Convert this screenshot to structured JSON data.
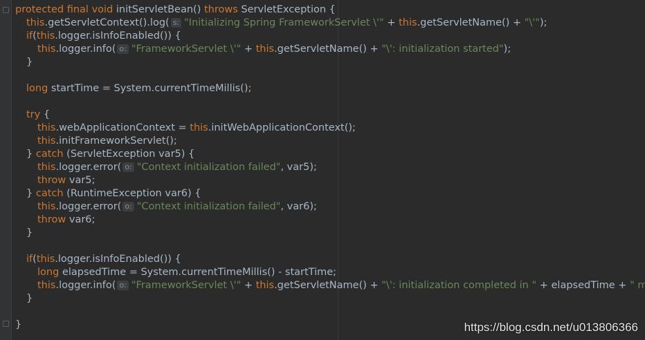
{
  "editor": {
    "watermark": "https://blog.csdn.net/u013806366",
    "tokens": {
      "protected": "protected",
      "final": "final",
      "void": "void",
      "throws": "throws",
      "this": "this",
      "if": "if",
      "long": "long",
      "try": "try",
      "catch": "catch",
      "throw": "throw"
    },
    "code": {
      "l1_sig": " initServletBean() ",
      "l1_exc": " ServletException {",
      "l2_a": ".getServletContext().log(",
      "l2_hint": "s:",
      "l2_s1": "\"Initializing Spring FrameworkServlet \\'\"",
      "l2_b": " + ",
      "l2_c": ".getServletName() + ",
      "l2_s2": "\"\\'\"",
      "l2_end": ");",
      "l3_a": "(",
      "l3_b": ".logger.isInfoEnabled()) {",
      "l4_a": ".logger.info(",
      "l4_hint": "o:",
      "l4_s1": "\"FrameworkServlet \\'\"",
      "l4_b": " + ",
      "l4_c": ".getServletName() + ",
      "l4_s2": "\"\\': initialization started\"",
      "l4_end": ");",
      "l5": "}",
      "l7_b": " startTime = System.currentTimeMillis();",
      "l9_b": " {",
      "l10_a": ".webApplicationContext = ",
      "l10_b": ".initWebApplicationContext();",
      "l11_a": ".initFrameworkServlet();",
      "l12_a": "} ",
      "l12_b": " (ServletException var5) {",
      "l13_a": ".logger.error(",
      "l13_hint": "o:",
      "l13_s": "\"Context initialization failed\"",
      "l13_b": ", var5);",
      "l14_b": " var5;",
      "l15_a": "} ",
      "l15_b": " (RuntimeException var6) {",
      "l16_a": ".logger.error(",
      "l16_hint": "o:",
      "l16_s": "\"Context initialization failed\"",
      "l16_b": ", var6);",
      "l17_b": " var6;",
      "l18": "}",
      "l20_a": "(",
      "l20_b": ".logger.isInfoEnabled()) {",
      "l21_b": " elapsedTime = System.currentTimeMillis() - startTime;",
      "l22_a": ".logger.info(",
      "l22_hint": "o:",
      "l22_s1": "\"FrameworkServlet \\'\"",
      "l22_b": " + ",
      "l22_c": ".getServletName() + ",
      "l22_s2": "\"\\': initialization completed in \"",
      "l22_d": " + elapsedTime + ",
      "l22_s3": "\" ms\"",
      "l22_end": ");",
      "l23": "}",
      "l25": "}"
    }
  }
}
